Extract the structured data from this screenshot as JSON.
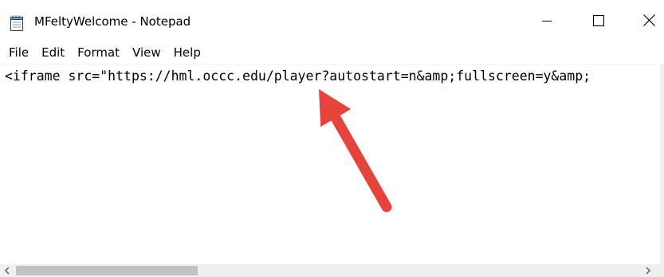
{
  "window": {
    "title": "MFeltyWelcome - Notepad",
    "app_icon": "notepad-icon",
    "controls": {
      "minimize_icon": "minimize-icon",
      "maximize_icon": "maximize-icon",
      "close_icon": "close-icon"
    }
  },
  "menubar": {
    "items": [
      {
        "label": "File"
      },
      {
        "label": "Edit"
      },
      {
        "label": "Format"
      },
      {
        "label": "View"
      },
      {
        "label": "Help"
      }
    ]
  },
  "editor": {
    "content": "<iframe src=\"https://hml.occc.edu/player?autostart=n&amp;fullscreen=y&amp;"
  },
  "scrollbar": {
    "left_icon": "chevron-left-icon",
    "right_icon": "chevron-right-icon"
  },
  "annotation": {
    "icon": "arrow-annotation-icon",
    "color": "#e5443d"
  }
}
